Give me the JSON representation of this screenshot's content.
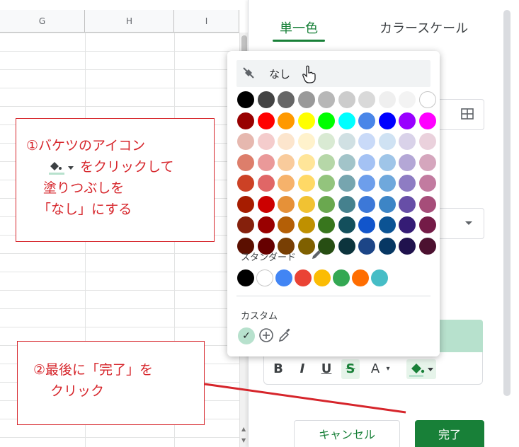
{
  "sheet": {
    "columns": [
      "G",
      "H",
      "I"
    ]
  },
  "panel": {
    "tabs": [
      {
        "label": "単一色",
        "active": true
      },
      {
        "label": "カラースケール",
        "active": false
      }
    ],
    "cancel_label": "キャンセル",
    "done_label": "完了",
    "format_buttons": [
      "B",
      "I",
      "U",
      "S",
      "A"
    ],
    "preview_color": "#b7e1cd",
    "accent_color": "#188038"
  },
  "popup": {
    "none_label": "なし",
    "standard_label": "スタンダード",
    "custom_label": "カスタム",
    "palette": [
      [
        "#000000",
        "#434343",
        "#666666",
        "#999999",
        "#b7b7b7",
        "#cccccc",
        "#d9d9d9",
        "#efefef",
        "#f3f3f3",
        "#ffffff"
      ],
      [
        "#980000",
        "#ff0000",
        "#ff9900",
        "#ffff00",
        "#00ff00",
        "#00ffff",
        "#4a86e8",
        "#0000ff",
        "#9900ff",
        "#ff00ff"
      ],
      [
        "#e6b8af",
        "#f4cccc",
        "#fce5cd",
        "#fff2cc",
        "#d9ead3",
        "#d0e0e3",
        "#c9daf8",
        "#cfe2f3",
        "#d9d2e9",
        "#ead1dc"
      ],
      [
        "#dd7e6b",
        "#ea9999",
        "#f9cb9c",
        "#ffe599",
        "#b6d7a8",
        "#a2c4c9",
        "#a4c2f4",
        "#9fc5e8",
        "#b4a7d6",
        "#d5a6bd"
      ],
      [
        "#cc4125",
        "#e06666",
        "#f6b26b",
        "#ffd966",
        "#93c47d",
        "#76a5af",
        "#6d9eeb",
        "#6fa8dc",
        "#8e7cc3",
        "#c27ba0"
      ],
      [
        "#a61c00",
        "#cc0000",
        "#e69138",
        "#f1c232",
        "#6aa84f",
        "#45818e",
        "#3c78d8",
        "#3d85c6",
        "#674ea7",
        "#a64d79"
      ],
      [
        "#85200c",
        "#990000",
        "#b45f06",
        "#bf9000",
        "#38761d",
        "#134f5c",
        "#1155cc",
        "#0b5394",
        "#351c75",
        "#741b47"
      ],
      [
        "#5b0f00",
        "#660000",
        "#783f04",
        "#7f6000",
        "#274e13",
        "#0c343d",
        "#1c4587",
        "#073763",
        "#20124d",
        "#4c1130"
      ]
    ],
    "standard_colors": [
      "#000000",
      "#ffffff",
      "#4285f4",
      "#ea4335",
      "#fbbc04",
      "#34a853",
      "#ff6d01",
      "#46bdc6"
    ],
    "custom_selected_color": "#b7e1cd"
  },
  "annotations": {
    "note1_lines": [
      "①バケツのアイコン",
      "をクリックして",
      "塗りつぶしを",
      "「なし」にする"
    ],
    "note2_lines": [
      "②最後に「完了」を",
      "クリック"
    ],
    "color": "#d6252b"
  }
}
